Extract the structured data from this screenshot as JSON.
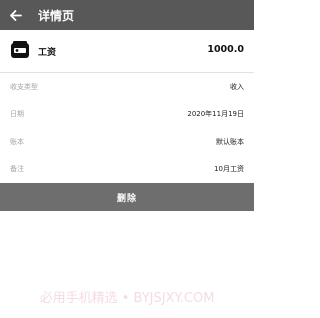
{
  "appbar": {
    "title": "详情页",
    "back_icon": "arrow-left-icon"
  },
  "record": {
    "category_icon": "wallet-icon",
    "category": "工资",
    "amount": "1000.0"
  },
  "details": [
    {
      "label": "收支类型",
      "value": "收入"
    },
    {
      "label": "日期",
      "value": "2020年11月19日"
    },
    {
      "label": "账本",
      "value": "默认账本"
    },
    {
      "label": "备注",
      "value": "10月工资"
    }
  ],
  "actions": {
    "delete_label": "删除"
  },
  "watermark": "必用手机精选 • BYJSJXY.COM",
  "colors": {
    "appbar_bg": "#585858",
    "delete_bg": "#6e6e6e",
    "watermark": "#f2dde3"
  }
}
